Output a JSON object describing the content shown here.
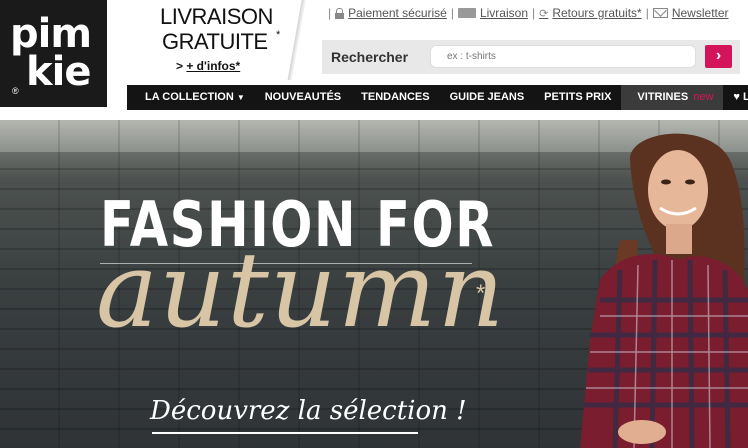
{
  "logo": {
    "line1": "pim",
    "line2": "kie",
    "registered": "®"
  },
  "promo": {
    "line1": "LIVRAISON",
    "line2": "GRATUITE",
    "star": "*",
    "more_prefix": "> ",
    "more_link": "+ d'infos*"
  },
  "toplinks": {
    "payment": "Paiement sécurisé",
    "delivery": "Livraison",
    "returns": "Retours gratuits*",
    "newsletter": "Newsletter"
  },
  "search": {
    "label": "Rechercher",
    "placeholder": "ex : t-shirts",
    "button": "›"
  },
  "nav": {
    "items": [
      "LA COLLECTION",
      "NOUVEAUTÉS",
      "TENDANCES",
      "GUIDE JEANS",
      "PETITS PRIX"
    ],
    "vitrines": "VITRINES",
    "vitrines_badge": "new",
    "look": "♥ LOO"
  },
  "hero": {
    "headline": "FASHION FOR",
    "script": "autumn",
    "star": "*",
    "cta": "Découvrez la sélection !"
  },
  "colors": {
    "accent": "#d4145a",
    "nav_bg": "#141414",
    "script_text": "#d8c5a6"
  }
}
